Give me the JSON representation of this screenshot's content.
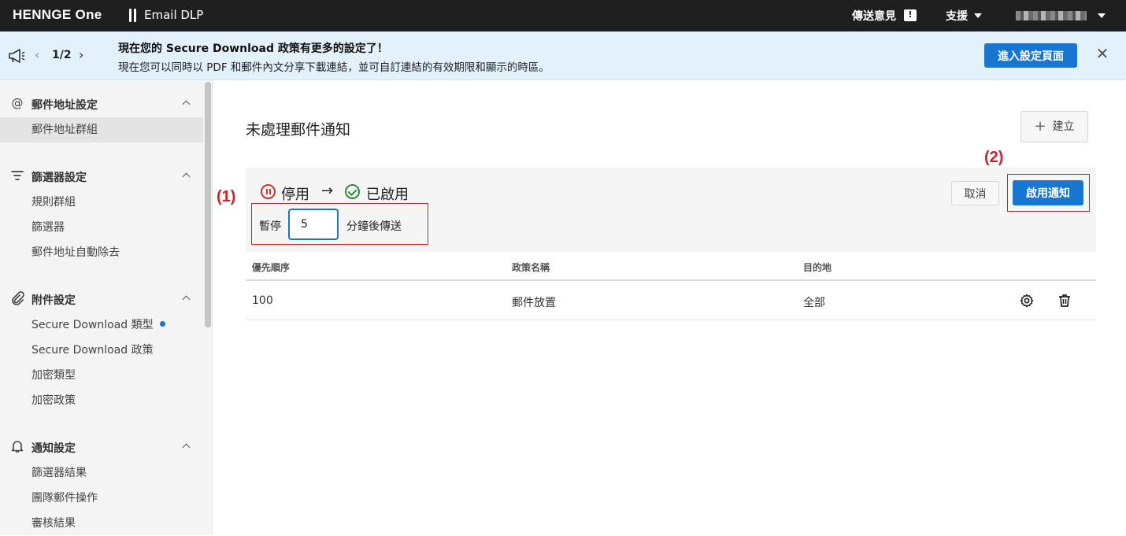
{
  "topbar": {
    "brand": "HENNGE One",
    "product": "Email DLP",
    "feedback": "傳送意見",
    "support": "支援"
  },
  "banner": {
    "pager": "1/2",
    "title": "現在您的 Secure Download 政策有更多的設定了！",
    "text": "現在您可以同時以 PDF 和郵件內文分享下載連結，並可自訂連結的有效期限和顯示的時區。",
    "cta": "進入設定頁面"
  },
  "sidebar": {
    "sections": [
      {
        "title": "郵件地址設定",
        "items": [
          "郵件地址群組"
        ]
      },
      {
        "title": "篩選器設定",
        "items": [
          "規則群組",
          "篩選器",
          "郵件地址自動除去"
        ]
      },
      {
        "title": "附件設定",
        "items": [
          "Secure Download 類型",
          "Secure Download 政策",
          "加密類型",
          "加密政策"
        ]
      },
      {
        "title": "通知設定",
        "items": [
          "篩選器結果",
          "團隊郵件操作",
          "審核結果"
        ]
      }
    ]
  },
  "main": {
    "title": "未處理郵件通知",
    "create_label": "建立",
    "status_from": "停用",
    "status_to": "已啟用",
    "annotation_1": "(1)",
    "annotation_2": "(2)",
    "pause_label": "暫停",
    "pause_minutes": "5",
    "pause_suffix": "分鐘後傳送",
    "cancel_label": "取消",
    "enable_label": "啟用通知"
  },
  "table": {
    "columns": [
      "優先順序",
      "政策名稱",
      "目的地"
    ],
    "rows": [
      {
        "priority": "100",
        "policy": "郵件放置",
        "destination": "全部"
      }
    ]
  },
  "colors": {
    "accent": "#1676d2",
    "annotation": "#d0222a",
    "disabled_status": "#c0392b",
    "enabled_status": "#2e8b3a",
    "topbar": "#1f1f1f",
    "banner_bg": "#e3f1fc"
  }
}
